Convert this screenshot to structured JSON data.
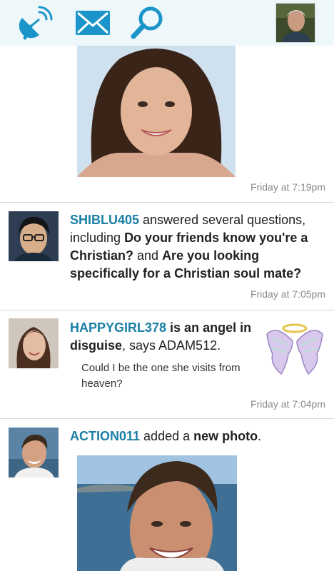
{
  "topbar": {
    "icons": [
      "satellite-dish-icon",
      "mail-icon",
      "search-icon"
    ],
    "profile_avatar": "current-user-avatar"
  },
  "feed": {
    "top_post": {
      "timestamp": "Friday at 7:19pm"
    },
    "post_questions": {
      "username": "SHIBLU405",
      "text_1": " answered several questions, including ",
      "question_1": "Do your friends know you're a Christian?",
      "text_2": " and ",
      "question_2": "Are you looking specifically for a Christian soul mate?",
      "timestamp": "Friday at 7:05pm"
    },
    "post_angel": {
      "username": "HAPPYGIRL378",
      "bold_text": " is an angel in disguise",
      "text": ", says ADAM512.",
      "quote": "Could I be the one she visits from heaven?",
      "timestamp": "Friday at 7:04pm"
    },
    "post_photo": {
      "username": "ACTION011",
      "text": " added a ",
      "bold_text": "new photo",
      "end": "."
    }
  },
  "colors": {
    "accent": "#1b95c9",
    "username": "#1b7fa5",
    "topbar_bg": "#eef8fb"
  }
}
